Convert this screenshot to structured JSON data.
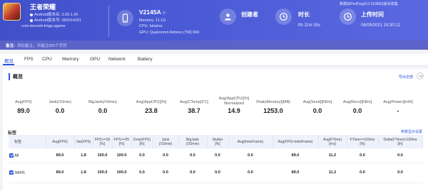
{
  "app": {
    "name": "王者荣耀",
    "android_version_line": "Android版本名: 3.65.1.42",
    "android_code_line": "Android版本号: 365014201",
    "package": "com.tencent.tmgp.sgame"
  },
  "device": {
    "name": "V2145A",
    "memory": "Memory: 11.1G",
    "cpu": "CPU: lahaina",
    "gpu": "GPU: Qualcomm Adreno (TM) 660"
  },
  "stats": {
    "creator_label": "创建者",
    "creator_value": "",
    "duration_label": "时长",
    "duration_value": "0h 11m 35s",
    "upload_label": "上传时间",
    "upload_value": "06/09/2021 19:30:12"
  },
  "top_note": "数据由PerfDog(6.0.210830)版本收集",
  "notebar": {
    "label": "备注:",
    "placeholder": "添加备注，不能过200个字符"
  },
  "tabs": [
    "概览",
    "FPS",
    "CPU",
    "Memory",
    "GPU",
    "Network",
    "Battery"
  ],
  "overview": {
    "title": "概览",
    "export_label": "导出全部"
  },
  "metrics": [
    {
      "label": "Avg(FPS)",
      "value": "89.0"
    },
    {
      "label": "Jank(/10min)",
      "value": "0.0"
    },
    {
      "label": "BigJank(/10min)",
      "value": "0.0"
    },
    {
      "label": "Avg(AppCPU)[%]",
      "value": "23.8"
    },
    {
      "label": "Avg(CTemp)[°C]",
      "value": "38.7"
    },
    {
      "label": "Avg(AppCPU)[%]\nNormalized",
      "value": "14.9"
    },
    {
      "label": "Peak(Memory)[MB]",
      "value": "1253.0"
    },
    {
      "label": "Avg(Send)[KB/s]",
      "value": "0.0"
    },
    {
      "label": "Avg(Recv)[KB/s]",
      "value": "0.0"
    },
    {
      "label": "Avg(Power)[mW]",
      "value": "-"
    }
  ],
  "labels_section": {
    "title": "标签",
    "settings_link": "参数显示设置"
  },
  "table": {
    "headers": [
      "标签",
      "Avg(FPS)",
      "Var(FPS)",
      "FPS>=18\n[%]",
      "FPS>=25\n[%]",
      "Drop(FPS)\n[/h]",
      "Jank\n(/10min)",
      "BigJank\n(/10min)",
      "Stutter\n[%]",
      "Avg(InterFrame)",
      "Avg(FPS+InterFrame)",
      "Avg(FTime)\n[ms]",
      "FTime>=100ms\n[%]",
      "Delta(FTime)>100ms\n[/h]"
    ],
    "rows": [
      {
        "label": "All",
        "cells": [
          "89.0",
          "1.8",
          "100.0",
          "100.0",
          "0.0",
          "0.0",
          "0.0",
          "0.0",
          "0.0",
          "89.0",
          "11.2",
          "0.0",
          "0.0"
        ]
      },
      {
        "label": "label1",
        "cells": [
          "89.0",
          "1.8",
          "100.0",
          "100.0",
          "0.0",
          "0.0",
          "0.0",
          "0.0",
          "0.0",
          "89.0",
          "11.2",
          "0.0",
          "0.0"
        ]
      }
    ]
  },
  "colors": {
    "header_bg": "#4b5bd6",
    "accent": "#2b56d8",
    "page_bg": "#f2f3f7"
  },
  "icons": {
    "device": "phone-icon",
    "creator": "user-icon",
    "duration": "clock-icon",
    "upload": "upload-clock-icon"
  }
}
